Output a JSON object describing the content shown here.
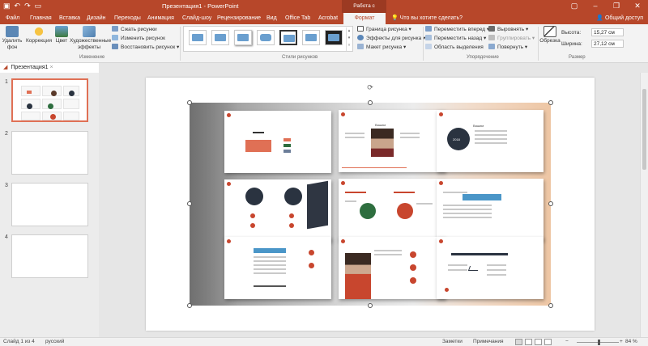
{
  "title_bar": {
    "title": "Презентация1 - PowerPoint",
    "context_label": "Работа с рисунками",
    "quick_access": [
      "save-icon",
      "undo-icon",
      "redo-icon",
      "present-icon"
    ]
  },
  "tabs": [
    {
      "label": "Файл"
    },
    {
      "label": "Главная"
    },
    {
      "label": "Вставка"
    },
    {
      "label": "Дизайн"
    },
    {
      "label": "Переходы"
    },
    {
      "label": "Анимация"
    },
    {
      "label": "Слайд-шоу"
    },
    {
      "label": "Рецензирование"
    },
    {
      "label": "Вид"
    },
    {
      "label": "Office Tab"
    },
    {
      "label": "Acrobat"
    },
    {
      "label": "Формат"
    }
  ],
  "tell_me": "Что вы хотите сделать?",
  "share": "Общий доступ",
  "ribbon": {
    "remove_bg": "Удалить фон",
    "corrections": "Коррекция",
    "color": "Цвет",
    "artistic": "Художественные эффекты",
    "compress": "Сжать рисунки",
    "change": "Изменить рисунок",
    "reset": "Восстановить рисунок",
    "group_adjust": "Изменение",
    "group_styles": "Стили рисунков",
    "border": "Граница рисунка",
    "effects": "Эффекты для рисунка",
    "layout": "Макет рисунка",
    "bring_forward": "Переместить вперед",
    "send_backward": "Переместить назад",
    "selection_pane": "Область выделения",
    "align": "Выровнять",
    "group": "Группировать",
    "rotate": "Повернуть",
    "group_arrange": "Упорядочение",
    "crop": "Обрезка",
    "height_label": "Высота:",
    "height_value": "15,27 см",
    "width_label": "Ширина:",
    "width_value": "27,12 см",
    "group_size": "Размер"
  },
  "section": {
    "label": "Презентация1"
  },
  "thumbnails": [
    {
      "num": "1"
    },
    {
      "num": "2"
    },
    {
      "num": "3"
    },
    {
      "num": "4"
    }
  ],
  "status": {
    "slide": "Слайд 1 из 4",
    "language": "русский",
    "notes": "Заметки",
    "comments": "Примечания",
    "zoom": "84 %"
  },
  "picture": {
    "labels": [
      "Вашим",
      "Вашим",
      "Вашим",
      "2018",
      "2018"
    ]
  },
  "colors": {
    "accent": "#b7472a",
    "accent_orange": "#e07055",
    "dark_circle": "#2a3340",
    "green_circle": "#2e6e3f"
  }
}
